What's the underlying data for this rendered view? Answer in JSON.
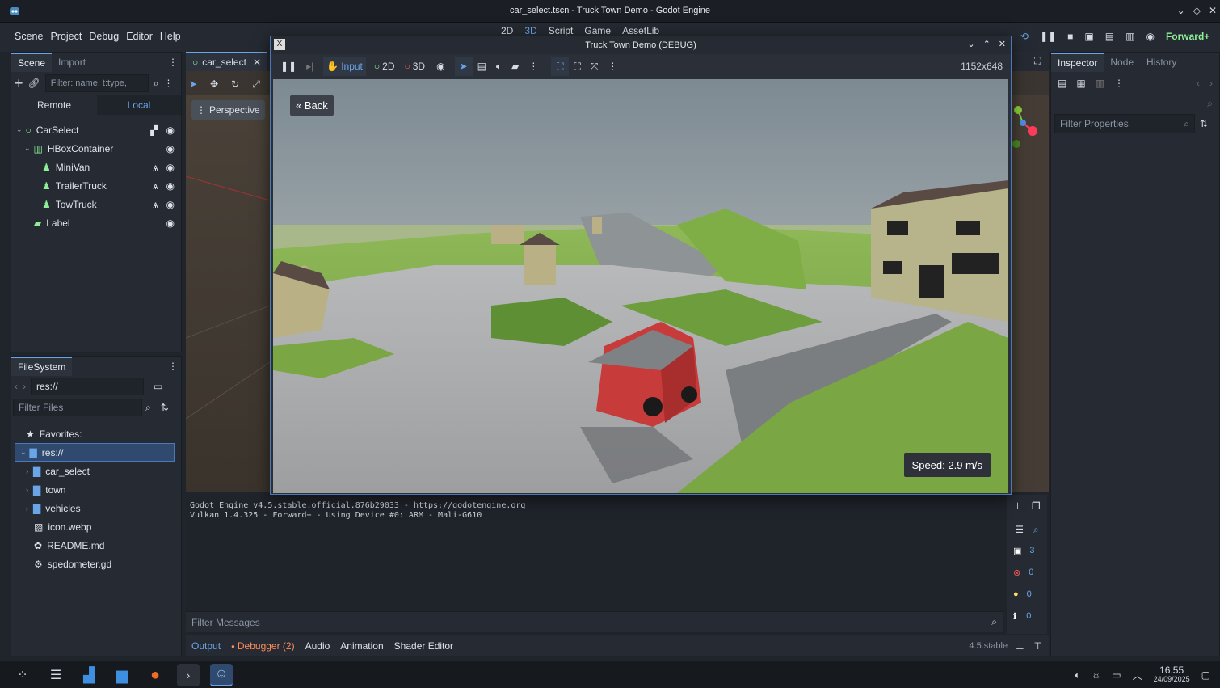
{
  "window": {
    "title": "car_select.tscn - Truck Town Demo - Godot Engine"
  },
  "menu": {
    "items": [
      "Scene",
      "Project",
      "Debug",
      "Editor",
      "Help"
    ]
  },
  "main_tabs": [
    "2D",
    "3D",
    "Script",
    "Game",
    "AssetLib"
  ],
  "renderer": "Forward+",
  "scene_dock": {
    "tabs": [
      "Scene",
      "Import"
    ],
    "filter_placeholder": "Filter: name, t:type,",
    "remote_label": "Remote",
    "local_label": "Local",
    "nodes": [
      {
        "name": "CarSelect",
        "depth": 0,
        "icon": "node3d-icon"
      },
      {
        "name": "HBoxContainer",
        "depth": 1,
        "icon": "hbox-icon"
      },
      {
        "name": "MiniVan",
        "depth": 2,
        "icon": "vehicle-icon"
      },
      {
        "name": "TrailerTruck",
        "depth": 2,
        "icon": "vehicle-icon"
      },
      {
        "name": "TowTruck",
        "depth": 2,
        "icon": "vehicle-icon"
      },
      {
        "name": "Label",
        "depth": 1,
        "icon": "label-icon"
      }
    ]
  },
  "filesystem": {
    "title": "FileSystem",
    "path": "res://",
    "filter_placeholder": "Filter Files",
    "favorites": "Favorites:",
    "root": "res://",
    "items": [
      {
        "name": "car_select",
        "type": "folder"
      },
      {
        "name": "town",
        "type": "folder"
      },
      {
        "name": "vehicles",
        "type": "folder"
      },
      {
        "name": "icon.webp",
        "type": "image"
      },
      {
        "name": "README.md",
        "type": "doc"
      },
      {
        "name": "spedometer.gd",
        "type": "script"
      }
    ]
  },
  "scene_tab": {
    "label": "car_select"
  },
  "viewport": {
    "perspective": "Perspective"
  },
  "game_window": {
    "title": "Truck Town Demo (DEBUG)",
    "input_label": "Input",
    "mode_2d": "2D",
    "mode_3d": "3D",
    "resolution": "1152x648",
    "back_button": "« Back",
    "speed": "Speed: 2.9 m/s"
  },
  "inspector": {
    "tabs": [
      "Inspector",
      "Node",
      "History"
    ],
    "filter_placeholder": "Filter Properties"
  },
  "output": {
    "lines": [
      "Godot Engine v4.5.stable.official.876b29033 - https://godotengine.org",
      "Vulkan 1.4.325 - Forward+ - Using Device #0: ARM - Mali-G610"
    ],
    "filter_placeholder": "Filter Messages",
    "counts": {
      "messages": "3",
      "errors": "0",
      "warnings": "0",
      "info": "0"
    }
  },
  "bottom_tabs": {
    "output": "Output",
    "debugger": "Debugger (2)",
    "audio": "Audio",
    "animation": "Animation",
    "shader": "Shader Editor",
    "version": "4.5.stable"
  },
  "taskbar": {
    "time": "16.55",
    "date": "24/09/2025"
  },
  "colors": {
    "accent": "#6aa5e8",
    "node_green": "#8eef97",
    "error": "#ff5d5d",
    "warning": "#ffdd65",
    "debugger": "#ff8c5a"
  }
}
